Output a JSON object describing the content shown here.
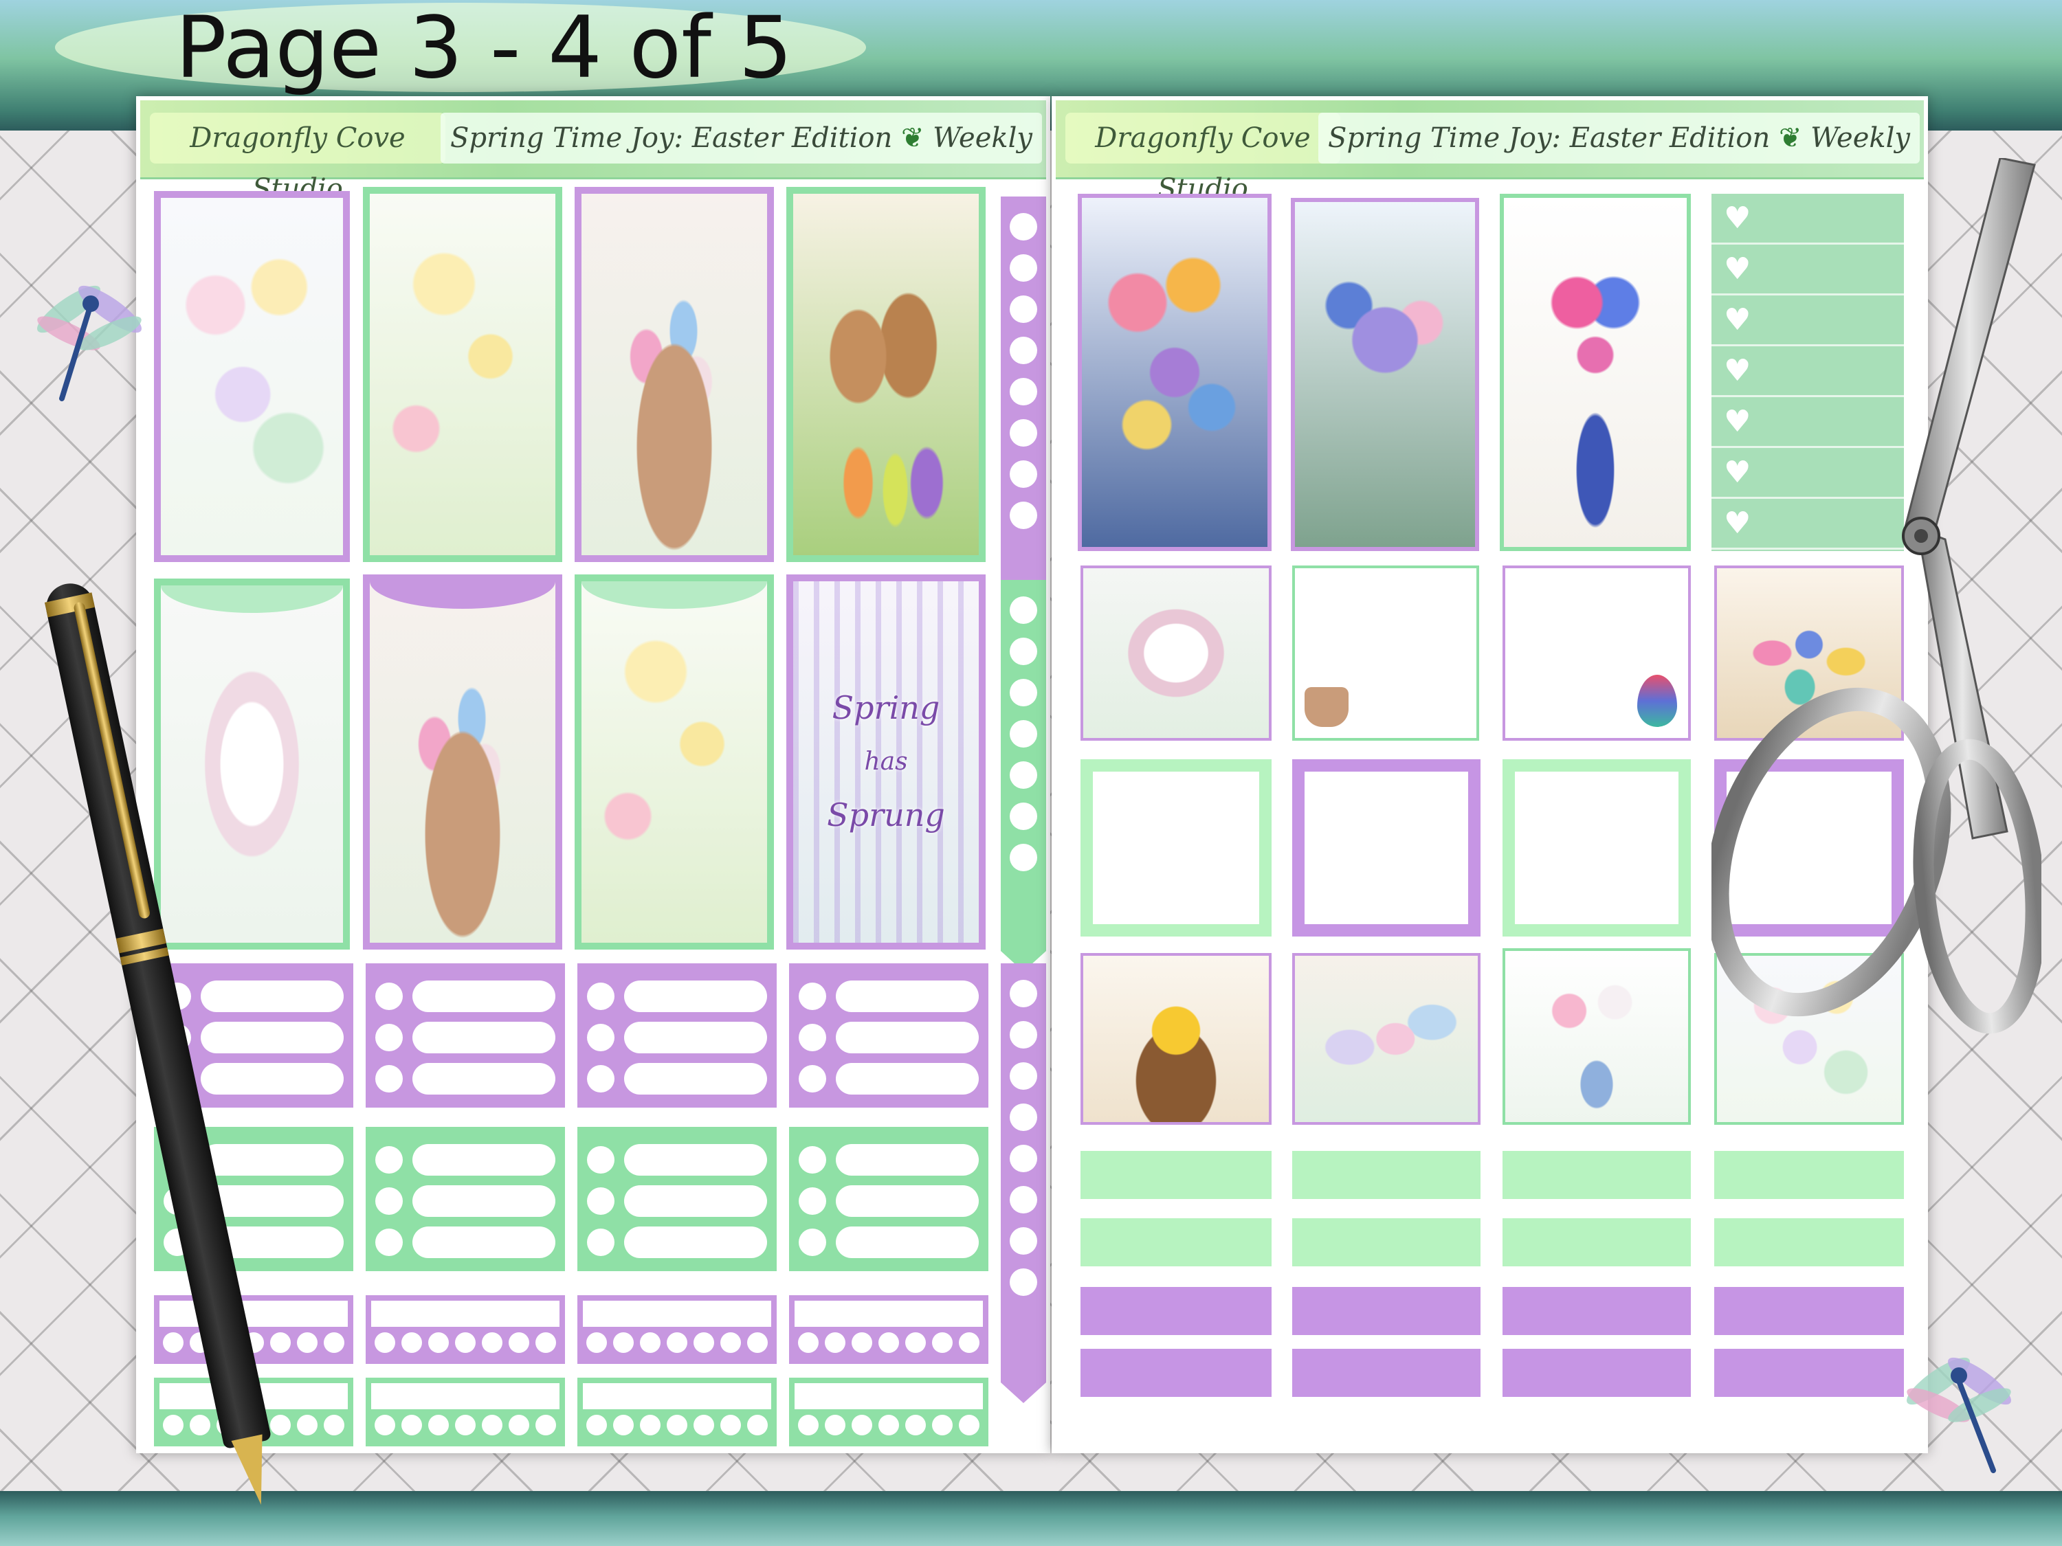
{
  "page_title": "Page 3 - 4 of 5",
  "left_sheet": {
    "brand": "Dragonfly Cove Studio",
    "edition": "Spring Time Joy: Easter Edition",
    "edition_suffix": "Weekly",
    "spring_sticker_lines": [
      "Spring",
      "has",
      "Sprung"
    ]
  },
  "right_sheet": {
    "brand": "Dragonfly Cove Studio",
    "edition": "Spring Time Joy: Easter Edition",
    "edition_suffix": "Weekly"
  },
  "colors": {
    "purple": "#c797e0",
    "green": "#8fe0a6",
    "highlight_green": "#b7f3c0",
    "highlight_purple": "#c695e4"
  },
  "icons": [
    "heart-icon",
    "dragonfly-icon",
    "pen-icon",
    "scissors-icon"
  ]
}
